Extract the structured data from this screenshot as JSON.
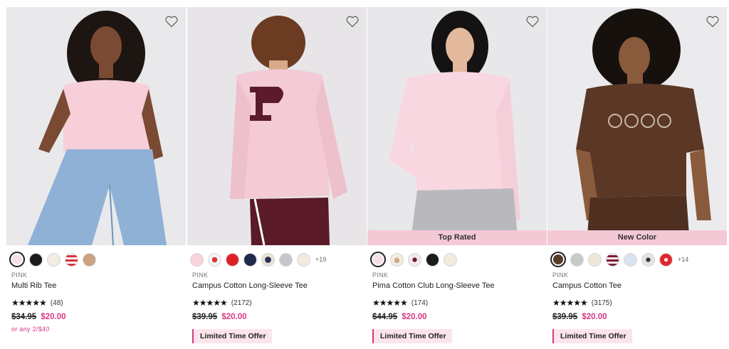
{
  "products": [
    {
      "brand": "PINK",
      "name": "Multi Rib Tee",
      "stars": "★★★★★",
      "reviews": "(48)",
      "price_original": "$34.95",
      "price_sale": "$20.00",
      "promo": "or any 2/$40",
      "swatch_colors": [
        "#f8dfe6",
        "#1b1b1b",
        "#f3ece0",
        "stripe-red",
        "#caa27f"
      ]
    },
    {
      "brand": "PINK",
      "name": "Campus Cotton Long-Sleeve Tee",
      "stars": "★★★★★",
      "reviews": "(2172)",
      "price_original": "$39.95",
      "price_sale": "$20.00",
      "offer": "Limited Time Offer",
      "more_swatches": "+19",
      "swatch_colors": [
        "#f7d3dc",
        "graphic-red",
        "#e02026",
        "#1f2a4a",
        "graphic-navy",
        "#c6c6c6",
        "#f1ebde"
      ]
    },
    {
      "brand": "PINK",
      "name": "Pima Cotton Club Long-Sleeve Tee",
      "stars": "★★★★★",
      "reviews": "(174)",
      "price_original": "$44.95",
      "price_sale": "$20.00",
      "offer": "Limited Time Offer",
      "ribbon": "Top Rated",
      "swatch_colors": [
        "#f8dde6",
        "graphic-cream",
        "graphic-star",
        "#1b1b1b",
        "#f1ebde"
      ]
    },
    {
      "brand": "PINK",
      "name": "Campus Cotton Tee",
      "stars": "★★★★★",
      "reviews": "(3175)",
      "price_original": "$39.95",
      "price_sale": "$20.00",
      "offer": "Limited Time Offer",
      "ribbon": "New Color",
      "more_swatches": "+14",
      "swatch_colors": [
        "#5a3a28",
        "#c9c9c9",
        "#efe8d8",
        "stripe-pink",
        "#d9e2ef",
        "graphic-grey",
        "graphic-red"
      ]
    }
  ],
  "colors": {
    "accent_pink": "#d53783",
    "ribbon_bg": "#f3c9d5",
    "offer_bg": "#fbe5ec"
  },
  "icons": {
    "favorite": "heart-outline-icon",
    "rating": "star-icon"
  }
}
